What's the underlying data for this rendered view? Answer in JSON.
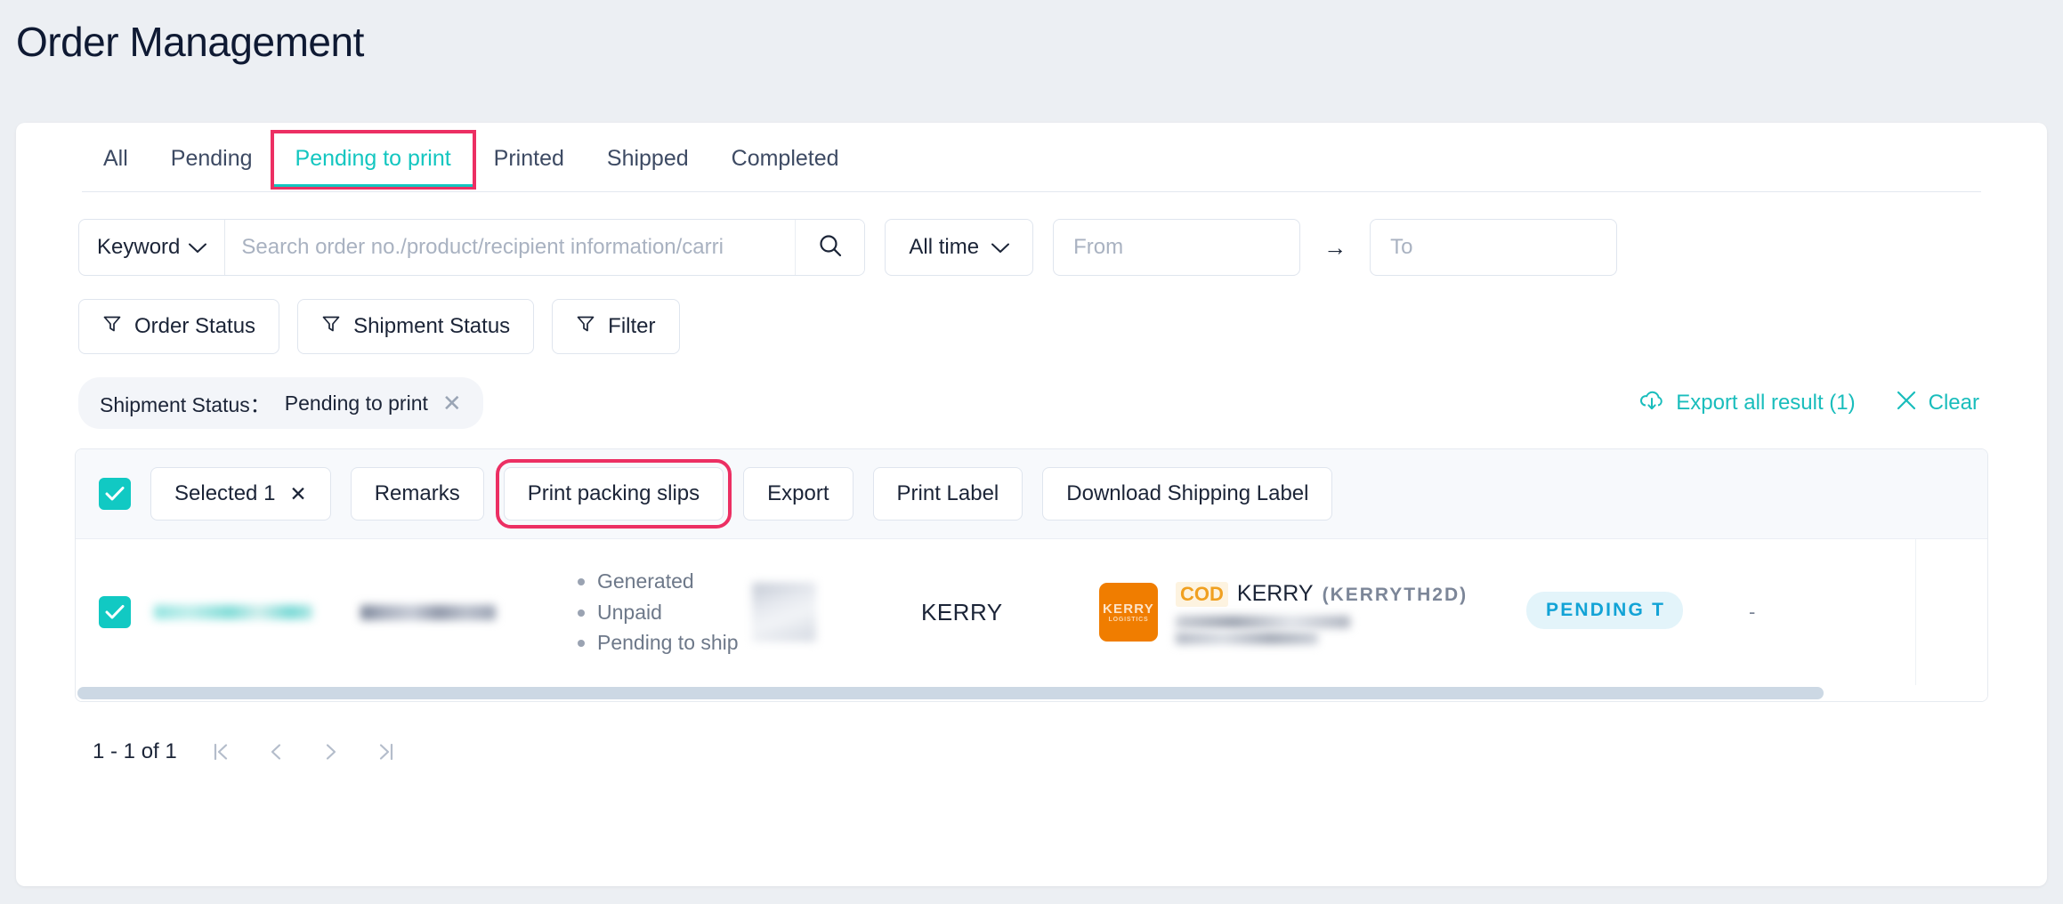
{
  "page": {
    "title": "Order Management"
  },
  "tabs": [
    {
      "label": "All",
      "active": false
    },
    {
      "label": "Pending",
      "active": false
    },
    {
      "label": "Pending to print",
      "active": true
    },
    {
      "label": "Printed",
      "active": false
    },
    {
      "label": "Shipped",
      "active": false
    },
    {
      "label": "Completed",
      "active": false
    }
  ],
  "search": {
    "keyword_label": "Keyword",
    "placeholder": "Search order no./product/recipient information/carri",
    "value": "",
    "time_label": "All time",
    "from_placeholder": "From",
    "from_value": "",
    "to_placeholder": "To",
    "to_value": "",
    "range_arrow": "→"
  },
  "filter_buttons": [
    {
      "label": "Order Status"
    },
    {
      "label": "Shipment Status"
    },
    {
      "label": "Filter"
    }
  ],
  "active_filters": {
    "chip_label": "Shipment Status：",
    "chip_value": "Pending to print",
    "export_all": "Export all result (1)",
    "clear": "Clear"
  },
  "toolbar": {
    "selected": "Selected 1",
    "selected_close": "✕",
    "remarks": "Remarks",
    "print_packing_slips": "Print packing slips",
    "export": "Export",
    "print_label": "Print Label",
    "download_shipping_label": "Download Shipping Label"
  },
  "row": {
    "statuses": [
      "Generated",
      "Unpaid",
      "Pending to ship"
    ],
    "carrier": "KERRY",
    "shipping": {
      "cod": "COD",
      "name": "KERRY",
      "code": "(KERRYTH2D)"
    },
    "badge": "PENDING T",
    "tail": "-"
  },
  "pagination": {
    "summary": "1 - 1 of 1"
  },
  "colors": {
    "accent_teal": "#13c6c0",
    "highlight_pink": "#ec2f63",
    "kerry_orange": "#f07d00",
    "badge_blue": "#12a3d6",
    "title_navy": "#0f1a33"
  }
}
